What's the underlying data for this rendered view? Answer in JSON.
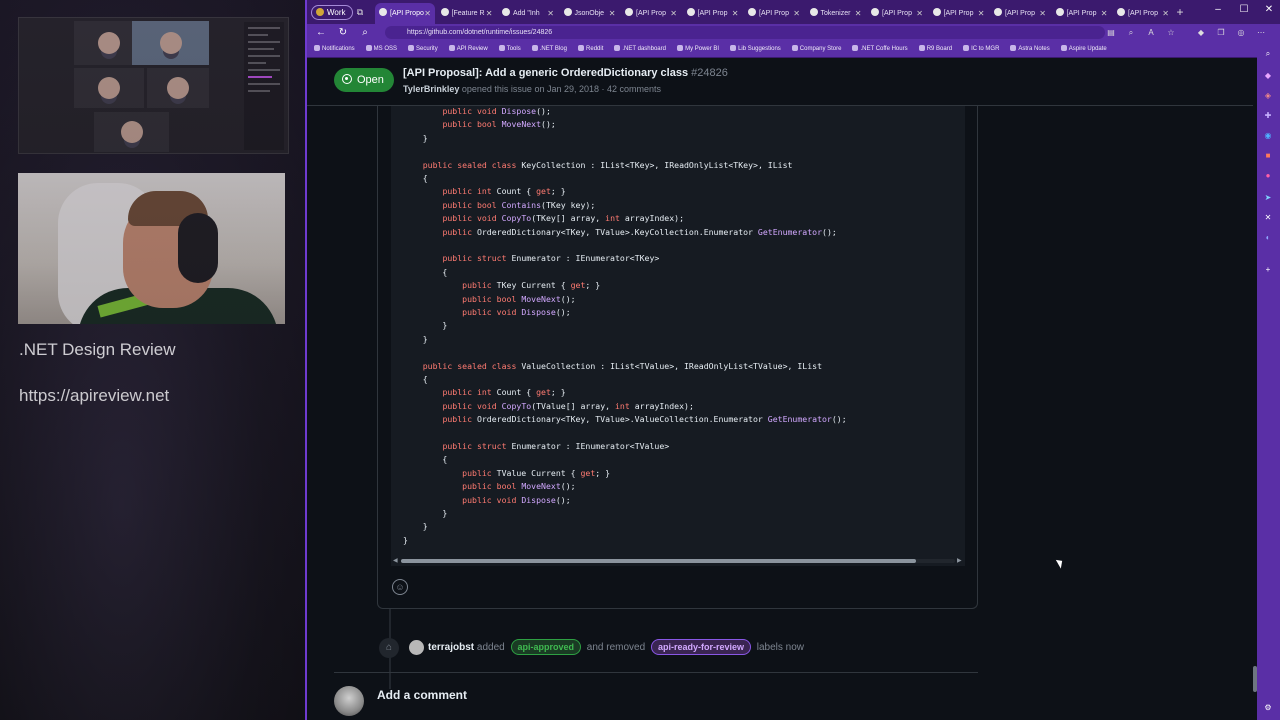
{
  "stream": {
    "title": ".NET Design Review",
    "url": "https://apireview.net"
  },
  "browser": {
    "profile": "Work",
    "tabs": [
      "[API Propo",
      "[Feature R",
      "Add \"Inh",
      "JsonObje",
      "[API Prop",
      "[API Prop",
      "[API Prop",
      "Tokenizer",
      "[API Prop",
      "[API Prop",
      "[API Prop",
      "[API Prop",
      "[API Prop"
    ],
    "url": "https://github.com/dotnet/runtime/issues/24826",
    "bookmarks": [
      "Notifications",
      "MS OSS",
      "Security",
      "API Review",
      "Tools",
      ".NET Blog",
      "Reddit",
      ".NET dashboard",
      "My Power BI",
      "Lib Suggestions",
      "Company Store",
      ".NET Coffe Hours",
      "R9 Board",
      "IC to MGR",
      "Astra Notes",
      "Aspire Update"
    ]
  },
  "issue": {
    "state": "Open",
    "title": "[API Proposal]: Add a generic OrderedDictionary class",
    "number": "#24826",
    "author": "TylerBrinkley",
    "meta": "opened this issue on Jan 29, 2018 · 42 comments"
  },
  "code_lines": [
    "        public void Dispose();",
    "        public bool MoveNext();",
    "    }",
    "",
    "    public sealed class KeyCollection : IList<TKey>, IReadOnlyList<TKey>, IList",
    "    {",
    "        public int Count { get; }",
    "        public bool Contains(TKey key);",
    "        public void CopyTo(TKey[] array, int arrayIndex);",
    "        public OrderedDictionary<TKey, TValue>.KeyCollection.Enumerator GetEnumerator();",
    "",
    "        public struct Enumerator : IEnumerator<TKey>",
    "        {",
    "            public TKey Current { get; }",
    "            public bool MoveNext();",
    "            public void Dispose();",
    "        }",
    "    }",
    "",
    "    public sealed class ValueCollection : IList<TValue>, IReadOnlyList<TValue>, IList",
    "    {",
    "        public int Count { get; }",
    "        public void CopyTo(TValue[] array, int arrayIndex);",
    "        public OrderedDictionary<TKey, TValue>.ValueCollection.Enumerator GetEnumerator();",
    "",
    "        public struct Enumerator : IEnumerator<TValue>",
    "        {",
    "            public TValue Current { get; }",
    "            public bool MoveNext();",
    "            public void Dispose();",
    "        }",
    "    }",
    "}"
  ],
  "event": {
    "actor": "terrajobst",
    "added_word": "added",
    "added_label": "api-approved",
    "removed_word": "and removed",
    "removed_label": "api-ready-for-review",
    "suffix": "labels now"
  },
  "add_comment": {
    "heading": "Add a comment"
  },
  "colors": {
    "open_green": "#238636",
    "edge_purple": "#5a2fa6",
    "keyword": "#ff7b72",
    "function": "#d2a8ff"
  }
}
